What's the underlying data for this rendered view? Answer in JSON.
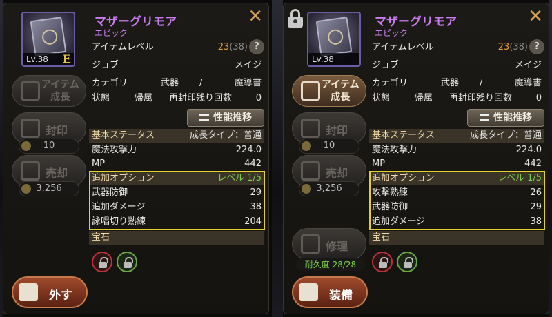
{
  "panels": [
    {
      "id": "equipped",
      "locked": false,
      "item": {
        "name": "マザーグリモア",
        "rarity": "エピック",
        "level_label": "Lv.38",
        "grade": "E"
      },
      "item_level_label": "アイテムレベル",
      "item_level": "23",
      "item_level_max": "(38)",
      "job_label": "ジョブ",
      "job": "メイジ",
      "category_label": "カテゴリ",
      "category_main": "武器",
      "category_sep": "/",
      "category_sub": "魔導書",
      "state_label": "状態",
      "state": "帰属",
      "reseal_label": "再封印残り回数",
      "reseal": "0",
      "trend_button": "性能推移",
      "base_header": "基本ステータス",
      "growth_type": "成長タイプ：普通",
      "base_stats": [
        {
          "label": "魔法攻撃力",
          "value": "224.0"
        },
        {
          "label": "MP",
          "value": "442"
        }
      ],
      "add_header": "追加オプション",
      "add_level": "レベル 1/5",
      "add_options": [
        {
          "label": "武器防御",
          "value": "29"
        },
        {
          "label": "追加ダメージ",
          "value": "38"
        },
        {
          "label": "詠唱切り熟練",
          "value": "204"
        }
      ],
      "gem_header": "宝石",
      "side": {
        "grow": "アイテム\n成長",
        "grow1": "アイテム",
        "grow2": "成長",
        "seal": "封印",
        "seal_count": "10",
        "sell": "売却",
        "sell_price": "3,256"
      },
      "action_button": "外す"
    },
    {
      "id": "compare",
      "locked": true,
      "item": {
        "name": "マザーグリモア",
        "rarity": "エピック",
        "level_label": "Lv.38",
        "grade": ""
      },
      "item_level_label": "アイテムレベル",
      "item_level": "23",
      "item_level_max": "(38)",
      "job_label": "ジョブ",
      "job": "メイジ",
      "category_label": "カテゴリ",
      "category_main": "武器",
      "category_sep": "/",
      "category_sub": "魔導書",
      "state_label": "状態",
      "state": "帰属",
      "reseal_label": "再封印残り回数",
      "reseal": "0",
      "trend_button": "性能推移",
      "base_header": "基本ステータス",
      "growth_type": "成長タイプ：普通",
      "base_stats": [
        {
          "label": "魔法攻撃力",
          "value": "224.0"
        },
        {
          "label": "MP",
          "value": "442"
        }
      ],
      "add_header": "追加オプション",
      "add_level": "レベル 1/5",
      "add_options": [
        {
          "label": "攻撃熟練",
          "value": "26"
        },
        {
          "label": "武器防御",
          "value": "29"
        },
        {
          "label": "追加ダメージ",
          "value": "38"
        }
      ],
      "gem_header": "宝石",
      "side": {
        "grow1": "アイテム",
        "grow2": "成長",
        "seal": "封印",
        "seal_count": "10",
        "sell": "売却",
        "sell_price": "3,256",
        "repair": "修理",
        "durability": "耐久度 28/28"
      },
      "action_button": "装備"
    }
  ],
  "colors": {
    "name": "#c87cf0",
    "level": "#e89b3c",
    "option_level": "#7fd04a",
    "highlight": "#e3d12a",
    "action_red": "#a04a2c"
  }
}
